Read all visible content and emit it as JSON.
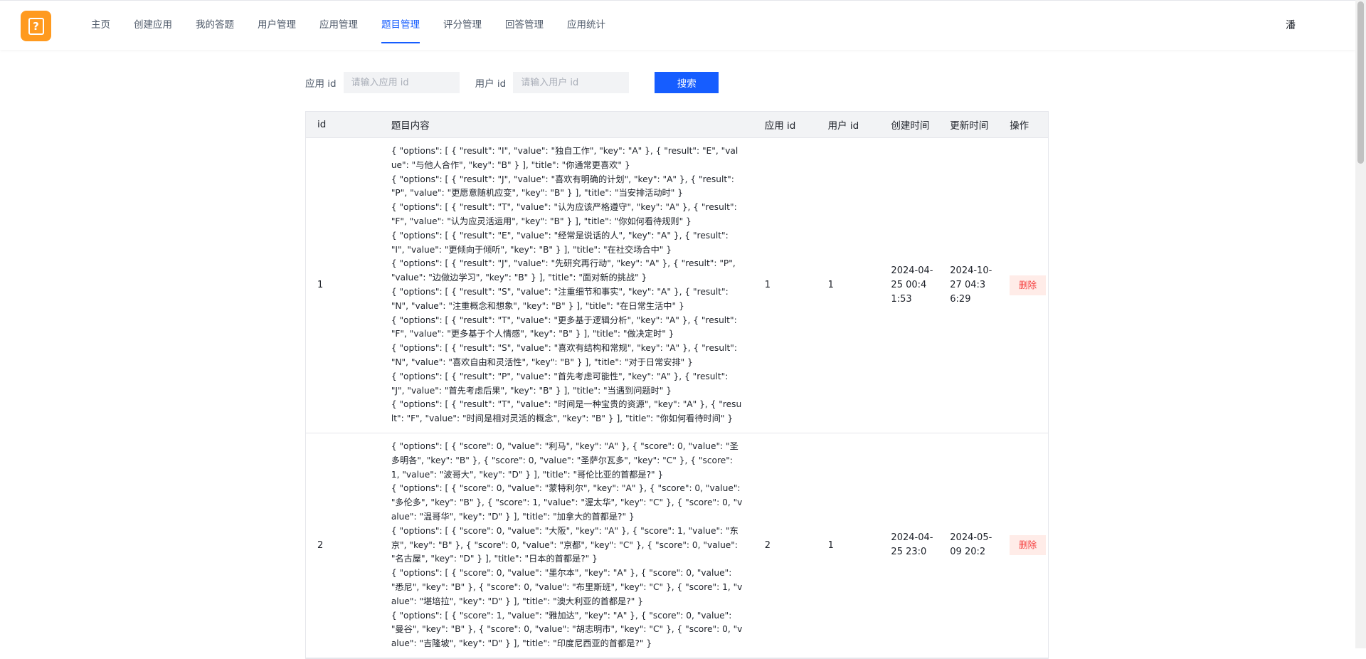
{
  "header": {
    "logo_glyph": "?",
    "nav": [
      {
        "label": "主页"
      },
      {
        "label": "创建应用"
      },
      {
        "label": "我的答题"
      },
      {
        "label": "用户管理"
      },
      {
        "label": "应用管理"
      },
      {
        "label": "题目管理",
        "active": true
      },
      {
        "label": "评分管理"
      },
      {
        "label": "回答管理"
      },
      {
        "label": "应用统计"
      }
    ],
    "user_name": "潘"
  },
  "search": {
    "app_id_label": "应用 id",
    "app_id_placeholder": "请输入应用 id",
    "user_id_label": "用户 id",
    "user_id_placeholder": "请输入用户 id",
    "button_label": "搜索"
  },
  "table": {
    "columns": {
      "id": "id",
      "content": "题目内容",
      "app_id": "应用 id",
      "user_id": "用户 id",
      "create_time": "创建时间",
      "update_time": "更新时间",
      "action": "操作"
    },
    "rows": [
      {
        "id": "1",
        "app_id": "1",
        "user_id": "1",
        "create_time": "2024-04-25 00:41:53",
        "update_time": "2024-10-27 04:36:29",
        "action_label": "删除",
        "content": [
          "{ \"options\": [ { \"result\": \"I\", \"value\": \"独自工作\", \"key\": \"A\" }, { \"result\": \"E\", \"value\": \"与他人合作\", \"key\": \"B\" } ], \"title\": \"你通常更喜欢\" }",
          "{ \"options\": [ { \"result\": \"J\", \"value\": \"喜欢有明确的计划\", \"key\": \"A\" }, { \"result\": \"P\", \"value\": \"更愿意随机应变\", \"key\": \"B\" } ], \"title\": \"当安排活动时\" }",
          "{ \"options\": [ { \"result\": \"T\", \"value\": \"认为应该严格遵守\", \"key\": \"A\" }, { \"result\": \"F\", \"value\": \"认为应灵活运用\", \"key\": \"B\" } ], \"title\": \"你如何看待规则\" }",
          "{ \"options\": [ { \"result\": \"E\", \"value\": \"经常是说话的人\", \"key\": \"A\" }, { \"result\": \"I\", \"value\": \"更倾向于倾听\", \"key\": \"B\" } ], \"title\": \"在社交场合中\" }",
          "{ \"options\": [ { \"result\": \"J\", \"value\": \"先研究再行动\", \"key\": \"A\" }, { \"result\": \"P\", \"value\": \"边做边学习\", \"key\": \"B\" } ], \"title\": \"面对新的挑战\" }",
          "{ \"options\": [ { \"result\": \"S\", \"value\": \"注重细节和事实\", \"key\": \"A\" }, { \"result\": \"N\", \"value\": \"注重概念和想象\", \"key\": \"B\" } ], \"title\": \"在日常生活中\" }",
          "{ \"options\": [ { \"result\": \"T\", \"value\": \"更多基于逻辑分析\", \"key\": \"A\" }, { \"result\": \"F\", \"value\": \"更多基于个人情感\", \"key\": \"B\" } ], \"title\": \"做决定时\" }",
          "{ \"options\": [ { \"result\": \"S\", \"value\": \"喜欢有结构和常规\", \"key\": \"A\" }, { \"result\": \"N\", \"value\": \"喜欢自由和灵活性\", \"key\": \"B\" } ], \"title\": \"对于日常安排\" }",
          "{ \"options\": [ { \"result\": \"P\", \"value\": \"首先考虑可能性\", \"key\": \"A\" }, { \"result\": \"J\", \"value\": \"首先考虑后果\", \"key\": \"B\" } ], \"title\": \"当遇到问题时\" }",
          "{ \"options\": [ { \"result\": \"T\", \"value\": \"时间是一种宝贵的资源\", \"key\": \"A\" }, { \"result\": \"F\", \"value\": \"时间是相对灵活的概念\", \"key\": \"B\" } ], \"title\": \"你如何看待时间\" }"
        ]
      },
      {
        "id": "2",
        "app_id": "2",
        "user_id": "1",
        "create_time": "2024-04-25 23:0",
        "update_time": "2024-05-09 20:2",
        "action_label": "删除",
        "content": [
          "{ \"options\": [ { \"score\": 0, \"value\": \"利马\", \"key\": \"A\" }, { \"score\": 0, \"value\": \"圣多明各\", \"key\": \"B\" }, { \"score\": 0, \"value\": \"圣萨尔瓦多\", \"key\": \"C\" }, { \"score\": 1, \"value\": \"波哥大\", \"key\": \"D\" } ], \"title\": \"哥伦比亚的首都是?\" }",
          "{ \"options\": [ { \"score\": 0, \"value\": \"蒙特利尔\", \"key\": \"A\" }, { \"score\": 0, \"value\": \"多伦多\", \"key\": \"B\" }, { \"score\": 1, \"value\": \"渥太华\", \"key\": \"C\" }, { \"score\": 0, \"value\": \"温哥华\", \"key\": \"D\" } ], \"title\": \"加拿大的首都是?\" }",
          "{ \"options\": [ { \"score\": 0, \"value\": \"大阪\", \"key\": \"A\" }, { \"score\": 1, \"value\": \"东京\", \"key\": \"B\" }, { \"score\": 0, \"value\": \"京都\", \"key\": \"C\" }, { \"score\": 0, \"value\": \"名古屋\", \"key\": \"D\" } ], \"title\": \"日本的首都是?\" }",
          "{ \"options\": [ { \"score\": 0, \"value\": \"墨尔本\", \"key\": \"A\" }, { \"score\": 0, \"value\": \"悉尼\", \"key\": \"B\" }, { \"score\": 0, \"value\": \"布里斯班\", \"key\": \"C\" }, { \"score\": 1, \"value\": \"堪培拉\", \"key\": \"D\" } ], \"title\": \"澳大利亚的首都是?\" }",
          "{ \"options\": [ { \"score\": 1, \"value\": \"雅加达\", \"key\": \"A\" }, { \"score\": 0, \"value\": \"曼谷\", \"key\": \"B\" }, { \"score\": 0, \"value\": \"胡志明市\", \"key\": \"C\" }, { \"score\": 0, \"value\": \"吉隆坡\", \"key\": \"D\" } ], \"title\": \"印度尼西亚的首都是?\" }"
        ]
      }
    ]
  }
}
